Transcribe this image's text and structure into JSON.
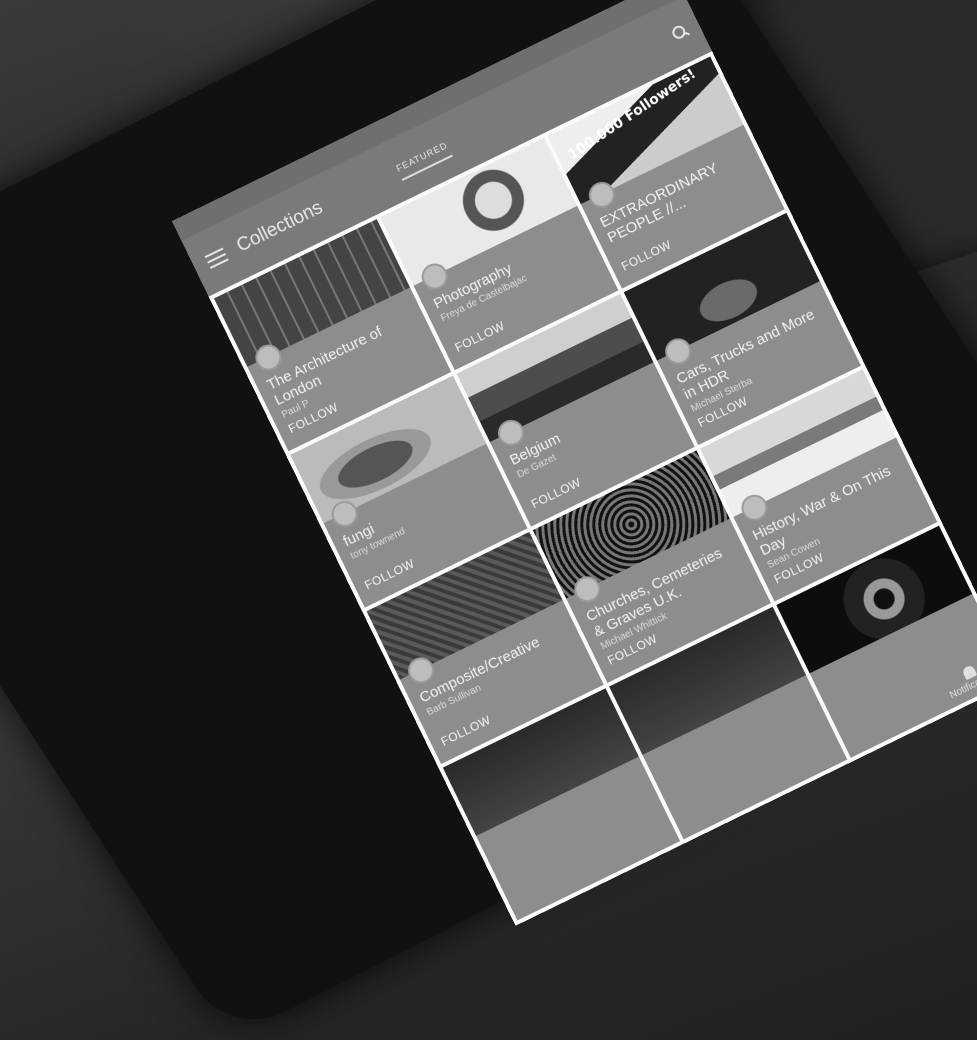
{
  "appbar": {
    "title": "Collections",
    "tab_featured": "FEATURED"
  },
  "cards": [
    {
      "title": "The Architecture of London",
      "author": "Paul P",
      "follow": "FOLLOW",
      "image": "architecture-photo"
    },
    {
      "title": "Photography",
      "author": "Freya de Castelbajac",
      "follow": "FOLLOW",
      "image": "portrait-photo"
    },
    {
      "title": "EXTRAORDINARY PEOPLE //...",
      "author": "",
      "follow": "FOLLOW",
      "image": "100000-followers-banner"
    },
    {
      "title": "fungi",
      "author": "tony townend",
      "follow": "FOLLOW",
      "image": "fungi-photo"
    },
    {
      "title": "Belgium",
      "author": "De Gazet",
      "follow": "FOLLOW",
      "image": "belgium-photo"
    },
    {
      "title": "Cars, Trucks and More in HDR",
      "author": "Michael Sterba",
      "follow": "FOLLOW",
      "image": "car-photo"
    },
    {
      "title": "Composite/Creative",
      "author": "Barb Sullivan",
      "follow": "FOLLOW",
      "image": "composite-photo"
    },
    {
      "title": "Churches, Cemeteries & Graves U.K.",
      "author": "Michael Whittick",
      "follow": "FOLLOW",
      "image": "stained-glass-photo"
    },
    {
      "title": "History, War & On This Day",
      "author": "Sean Cowen",
      "follow": "FOLLOW",
      "image": "ship-photo"
    },
    {
      "title": "",
      "author": "",
      "follow": "",
      "image": "dark-photo"
    },
    {
      "title": "",
      "author": "",
      "follow": "",
      "image": "dark-photo"
    },
    {
      "title": "",
      "author": "",
      "follow": "",
      "image": "eye-photo"
    }
  ],
  "bottom": {
    "notifications_label": "Notifications"
  },
  "banner_text": "100.000 Followers!",
  "icons": {
    "menu": "hamburger-icon",
    "search": "search-icon",
    "bell": "bell-icon"
  }
}
